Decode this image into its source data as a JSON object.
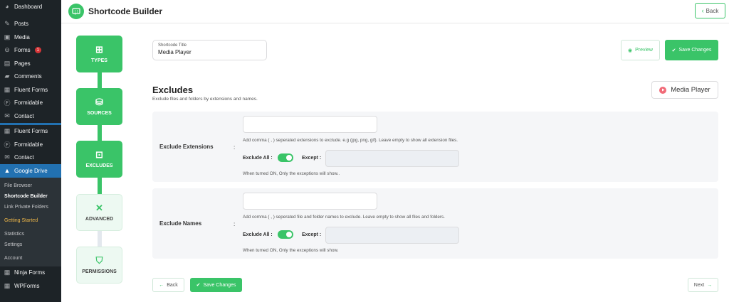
{
  "wp_menu": {
    "top": [
      {
        "label": "Dashboard",
        "icon": "dashboard-icon",
        "glyph": "◕"
      },
      {
        "label": "Posts",
        "icon": "pin-icon",
        "glyph": "✎"
      },
      {
        "label": "Media",
        "icon": "media-icon",
        "glyph": "▣"
      },
      {
        "label": "Forms",
        "icon": "forms-icon",
        "glyph": "⊖",
        "badge": "1"
      },
      {
        "label": "Pages",
        "icon": "pages-icon",
        "glyph": "▤"
      },
      {
        "label": "Comments",
        "icon": "comments-icon",
        "glyph": "▰"
      },
      {
        "label": "Fluent Forms",
        "icon": "fluent-forms-icon",
        "glyph": "▦"
      },
      {
        "label": "Formidable",
        "icon": "formidable-icon",
        "glyph": "Ⓕ"
      },
      {
        "label": "Contact",
        "icon": "mail-icon",
        "glyph": "✉"
      }
    ],
    "repeat": [
      {
        "label": "Fluent Forms",
        "icon": "fluent-forms-icon",
        "glyph": "▦"
      },
      {
        "label": "Formidable",
        "icon": "formidable-icon",
        "glyph": "Ⓕ"
      },
      {
        "label": "Contact",
        "icon": "mail-icon",
        "glyph": "✉"
      }
    ],
    "active": {
      "label": "Google Drive",
      "icon": "google-drive-icon",
      "glyph": "▲"
    },
    "submenu": [
      "File Browser",
      "Shortcode Builder",
      "Link Private Folders"
    ],
    "getting_started": "Getting Started",
    "submenu2": [
      "Statistics",
      "Settings"
    ],
    "account": "Account",
    "bottom": [
      {
        "label": "Ninja Forms",
        "icon": "ninja-forms-icon",
        "glyph": "▦"
      },
      {
        "label": "WPForms",
        "icon": "wpforms-icon",
        "glyph": "▦"
      }
    ]
  },
  "header": {
    "title": "Shortcode Builder",
    "back_label": "Back"
  },
  "steps": [
    {
      "label": "TYPES",
      "icon": "types-icon",
      "glyph": "⊞",
      "state": "done"
    },
    {
      "label": "SOURCES",
      "icon": "database-icon",
      "glyph": "⛁",
      "state": "done"
    },
    {
      "label": "EXCLUDES",
      "icon": "excludes-icon",
      "glyph": "⊡",
      "state": "done"
    },
    {
      "label": "ADVANCED",
      "icon": "tools-icon",
      "glyph": "✕",
      "state": "pending"
    },
    {
      "label": "PERMISSIONS",
      "icon": "shield-icon",
      "glyph": "⛉",
      "state": "pending"
    }
  ],
  "shortcode": {
    "title_label": "Shortcode Title",
    "title_value": "Media Player"
  },
  "buttons": {
    "preview": "Preview",
    "save": "Save Changes",
    "back": "Back",
    "next": "Next"
  },
  "section": {
    "title": "Excludes",
    "description": "Exclude files and folders by extensions and names.",
    "module": "Media Player"
  },
  "settings": [
    {
      "label": "Exclude Extensions",
      "colon": ":",
      "input_value": "",
      "help": "Add comma ( , ) seperated extensions to exclude. e.g (jpg, png, gif). Leave empty to show all extension files.",
      "exclude_all_label": "Exclude All :",
      "exclude_all_on": true,
      "except_label": "Except :",
      "except_value": "",
      "note": "When turned ON, Only the exceptions will show.."
    },
    {
      "label": "Exclude Names",
      "colon": ":",
      "input_value": "",
      "help": "Add comma ( , ) seperated file and folder names to exclude. Leave empty to show all files and folders.",
      "exclude_all_label": "Exclude All :",
      "exclude_all_on": true,
      "except_label": "Except :",
      "except_value": "",
      "note": "When turned ON, Only the exceptions will show."
    }
  ],
  "colors": {
    "accent": "#3ac468",
    "wp_sidebar": "#1d2327",
    "wp_active": "#2271b1",
    "badge": "#d63638"
  }
}
